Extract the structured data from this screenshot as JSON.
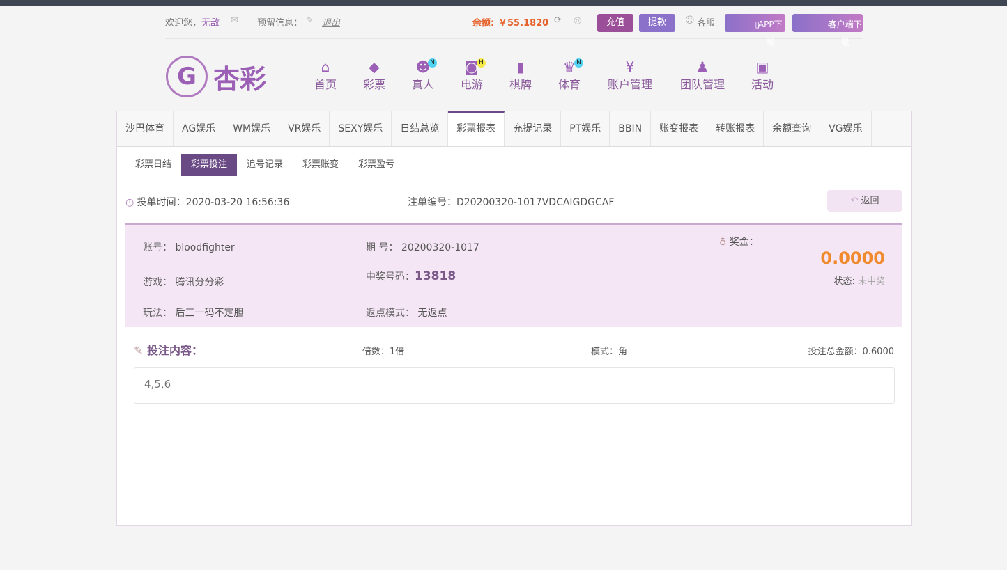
{
  "topbar": {
    "welcome": "欢迎您，",
    "username": "无敌",
    "reserved_label": "预留信息：",
    "logout": "退出",
    "balance_label": "余额:",
    "balance": "￥55.1820",
    "deposit": "充值",
    "withdraw": "提款",
    "service": "客服",
    "app_download": "APP下载",
    "client_download": "客户端下载"
  },
  "logo": {
    "text": "杏彩"
  },
  "nav": [
    {
      "label": "首页",
      "icon": "home-icon"
    },
    {
      "label": "彩票",
      "icon": "ticket-icon"
    },
    {
      "label": "真人",
      "icon": "live-dealer-icon",
      "badge": "N"
    },
    {
      "label": "电游",
      "icon": "gamepad-icon",
      "badge": "H"
    },
    {
      "label": "棋牌",
      "icon": "cards-icon"
    },
    {
      "label": "体育",
      "icon": "trophy-icon",
      "badge": "N"
    },
    {
      "label": "账户管理",
      "icon": "yen-icon"
    },
    {
      "label": "团队管理",
      "icon": "team-icon"
    },
    {
      "label": "活动",
      "icon": "gift-icon"
    }
  ],
  "tabs": [
    "沙巴体育",
    "AG娱乐",
    "WM娱乐",
    "VR娱乐",
    "SEXY娱乐",
    "日结总览",
    "彩票报表",
    "充提记录",
    "PT娱乐",
    "BBIN",
    "账变报表",
    "转账报表",
    "余额查询",
    "VG娱乐"
  ],
  "subtabs": [
    "彩票日结",
    "彩票投注",
    "追号记录",
    "彩票账变",
    "彩票盈亏"
  ],
  "order": {
    "time_label": "投单时间：",
    "time": "2020-03-20 16:56:36",
    "id_label": "注单编号：",
    "id": "D20200320-1017VDCAIGDGCAF",
    "back": "返回"
  },
  "detail": {
    "account_label": "账号：",
    "account": "bloodfighter",
    "game_label": "游戏：",
    "game": "腾讯分分彩",
    "play_label": "玩法：",
    "play": "后三一码不定胆",
    "issue_label": "期 号：",
    "issue": "20200320-1017",
    "win_no_label": "中奖号码：",
    "win_no": "13818",
    "rebate_label": "返点模式：",
    "rebate": "无返点",
    "prize_label": "奖金：",
    "prize": "0.0000",
    "status_label": "状态:",
    "status": "未中奖"
  },
  "bet": {
    "title": "投注内容：",
    "multiple_label": "倍数：",
    "multiple": "1倍",
    "mode_label": "模式：",
    "mode": "角",
    "total_label": "投注总金额：",
    "total": "0.6000",
    "content": "4,5,6"
  }
}
